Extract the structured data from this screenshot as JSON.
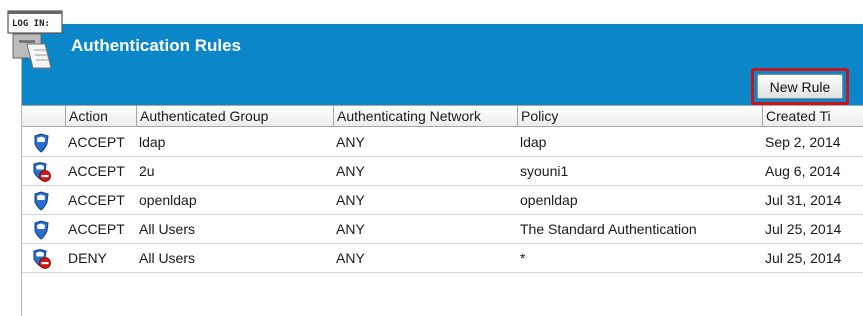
{
  "header": {
    "title": "Authentication Rules",
    "logo_text": "LOG IN:",
    "accent_color": "#0b86c9"
  },
  "toolbar": {
    "new_rule_label": "New Rule"
  },
  "table": {
    "columns": [
      "Action",
      "Authenticated Group",
      "Authenticating Network",
      "Policy",
      "Created Ti"
    ],
    "rows": [
      {
        "icon": "shield-icon",
        "action": "ACCEPT",
        "group": "ldap",
        "network": "ANY",
        "policy": "ldap",
        "created": "Sep 2, 2014"
      },
      {
        "icon": "shield-deny-icon",
        "action": "ACCEPT",
        "group": "2u",
        "network": "ANY",
        "policy": "syouni1",
        "created": "Aug 6, 2014"
      },
      {
        "icon": "shield-icon",
        "action": "ACCEPT",
        "group": "openldap",
        "network": "ANY",
        "policy": "openldap",
        "created": "Jul 31, 2014"
      },
      {
        "icon": "shield-icon",
        "action": "ACCEPT",
        "group": "All Users",
        "network": "ANY",
        "policy": "The Standard Authentication",
        "created": "Jul 25, 2014"
      },
      {
        "icon": "shield-deny-icon",
        "action": "DENY",
        "group": "All Users",
        "network": "ANY",
        "policy": "*",
        "created": "Jul 25, 2014"
      }
    ]
  }
}
